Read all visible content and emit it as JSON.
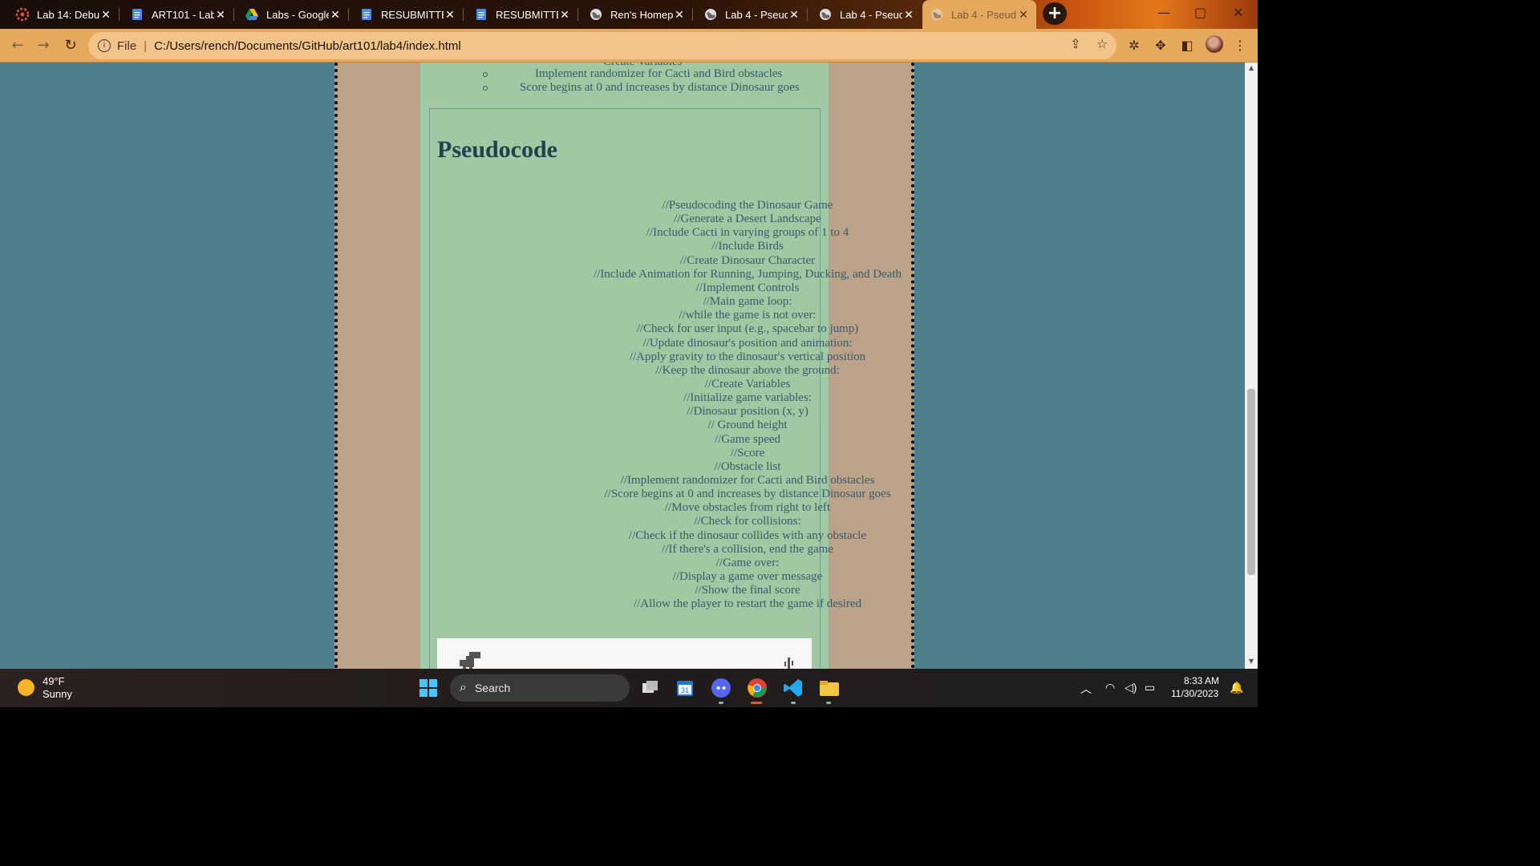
{
  "browser": {
    "tabs": [
      {
        "title": "Lab 14: Debu",
        "icon": "gear-red-icon"
      },
      {
        "title": "ART101 - Lab",
        "icon": "google-docs-icon"
      },
      {
        "title": "Labs - Google",
        "icon": "google-drive-icon"
      },
      {
        "title": "RESUBMITTED",
        "icon": "google-docs-icon"
      },
      {
        "title": "RESUBMITTED",
        "icon": "google-docs-icon"
      },
      {
        "title": "Ren's Homep",
        "icon": "globe-icon"
      },
      {
        "title": "Lab 4 - Pseud",
        "icon": "globe-icon"
      },
      {
        "title": "Lab 4 - Pseud",
        "icon": "globe-icon"
      },
      {
        "title": "Lab 4 - Pseud",
        "icon": "globe-icon",
        "active": true
      }
    ],
    "new_tab_label": "+",
    "close_glyph": "✕",
    "omnibox": {
      "scheme": "File",
      "separator": "|",
      "url": "C:/Users/rench/Documents/GitHub/art101/lab4/index.html"
    },
    "accent_color": "#e6a85c"
  },
  "page": {
    "list_top_partial": "Create Variables",
    "list_items": [
      "Implement randomizer for Cacti and Bird obstacles",
      "Score begins at 0 and increases by distance Dinosaur goes"
    ],
    "pseudocode_heading": "Pseudocode",
    "pseudocode_lines": [
      "//Pseudocoding the Dinosaur Game",
      "//Generate a Desert Landscape",
      "//Include Cacti in varying groups of 1 to 4",
      "//Include Birds",
      "//Create Dinosaur Character",
      "//Include Animation for Running, Jumping, Ducking, and Death",
      "//Implement Controls",
      "//Main game loop:",
      "//while the game is not over:",
      "//Check for user input (e.g., spacebar to jump)",
      "//Update dinosaur's position and animation:",
      "//Apply gravity to the dinosaur's vertical position",
      "//Keep the dinosaur above the ground:",
      "//Create Variables",
      "//Initialize game variables:",
      "//Dinosaur position (x, y)",
      "// Ground height",
      "//Game speed",
      "//Score",
      "//Obstacle list",
      "//Implement randomizer for Cacti and Bird obstacles",
      "//Score begins at 0 and increases by distance Dinosaur goes",
      "//Move obstacles from right to left",
      "//Check for collisions:",
      "//Check if the dinosaur collides with any obstacle",
      "//If there's a collision, end the game",
      "//Game over:",
      "//Display a game over message",
      "//Show the final score",
      "//Allow the player to restart the game if desired"
    ]
  },
  "taskbar": {
    "weather_temp": "49°F",
    "weather_desc": "Sunny",
    "search_label": "Search",
    "calendar_day": "31",
    "time": "8:33 AM",
    "date": "11/30/2023"
  }
}
